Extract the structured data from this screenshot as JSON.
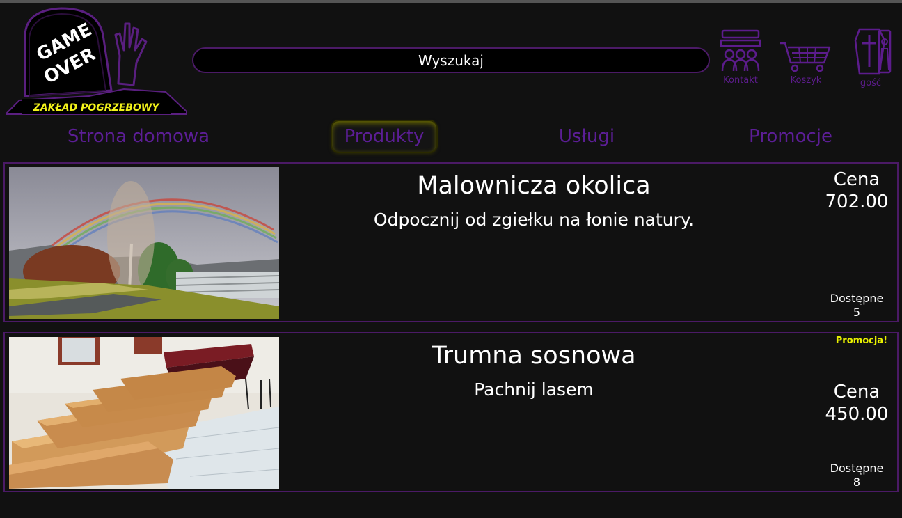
{
  "brand": {
    "logo_line1": "GAME",
    "logo_line2": "OVER",
    "logo_tagline": "ZAKŁAD POGRZEBOWY",
    "tagline_color": "#f2f21a"
  },
  "search": {
    "label": "Wyszukaj"
  },
  "header_icons": [
    {
      "label": "Kontakt",
      "icon": "contact-icon"
    },
    {
      "label": "Koszyk",
      "icon": "cart-icon"
    },
    {
      "label": "gość",
      "icon": "coffin-user-icon"
    }
  ],
  "nav": [
    {
      "label": "Strona domowa",
      "active": false
    },
    {
      "label": "Produkty",
      "active": true
    },
    {
      "label": "Usługi",
      "active": false
    },
    {
      "label": "Promocje",
      "active": false
    }
  ],
  "products": [
    {
      "title": "Malownicza okolica",
      "description": "Odpocznij od zgiełku na łonie natury.",
      "price_label": "Cena",
      "price": "702.00",
      "available_label": "Dostępne",
      "available": "5",
      "promo": "",
      "image": "cemetery-rainbow-photo"
    },
    {
      "title": "Trumna sosnowa",
      "description": "Pachnij lasem",
      "price_label": "Cena",
      "price": "450.00",
      "available_label": "Dostępne",
      "available": "8",
      "promo": "Promocja!",
      "image": "coffins-photo"
    }
  ],
  "colors": {
    "background": "#111111",
    "accent_purple": "#5c1e96",
    "border_purple": "#4b1a66",
    "promo_yellow": "#e8f000"
  }
}
